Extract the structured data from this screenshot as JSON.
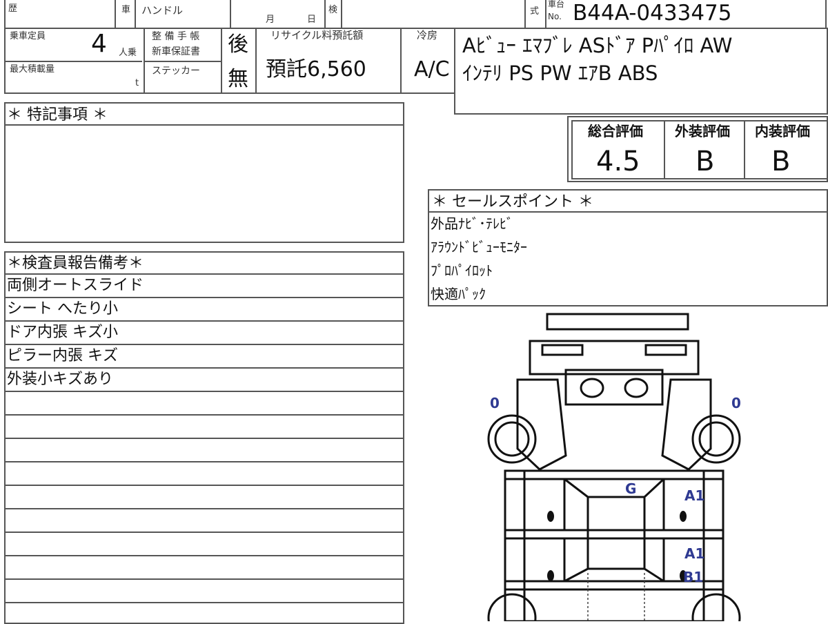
{
  "header": {
    "history_label": "歴",
    "car_label": "車",
    "handle_label": "ハンドル",
    "month_label": "月",
    "day_label": "日",
    "inspection_label": "検",
    "type_label": "式",
    "chassis_label": "車台",
    "no_label": "No.",
    "chassis_number": "B44A-0433475"
  },
  "specs": {
    "capacity_label": "乗車定員",
    "capacity_value": "4",
    "capacity_unit": "人乗",
    "max_load_label": "最大積載量",
    "max_load_unit": "t",
    "maintenance_label": "整 備 手 帳",
    "warranty_label": "新車保証書",
    "sticker_label": "ステッカー",
    "maintenance_value": "後",
    "sticker_value": "無",
    "recycle_label": "リサイクル料預託額",
    "recycle_value": "預託6,560",
    "aircon_label": "冷房",
    "aircon_value": "A/C"
  },
  "equipment": {
    "line1": "Aﾋﾞｭｰ ｴﾏﾌﾞﾚ ASﾄﾞｱ Pﾊﾟｲﾛ AW",
    "line2": "ｲﾝﾃﾘ PS PW ｴｱB ABS"
  },
  "grades": {
    "overall_label": "総合評価",
    "exterior_label": "外装評価",
    "interior_label": "内装評価",
    "overall_value": "4.5",
    "exterior_value": "B",
    "interior_value": "B"
  },
  "special_notes": {
    "title": "＊ 特記事項 ＊"
  },
  "sales_points": {
    "title": "＊ セールスポイント ＊",
    "items": [
      "外品ﾅﾋﾞ･ﾃﾚﾋﾞ",
      "ｱﾗｳﾝﾄﾞﾋﾞｭｰﾓﾆﾀｰ",
      "ﾌﾟﾛﾊﾟｲﾛｯﾄ",
      "快適ﾊﾟｯｸ"
    ]
  },
  "inspector_report": {
    "title": "＊検査員報告備考＊",
    "items": [
      "両側オートスライド",
      "シート へたり小",
      "ドア内張 キズ小",
      "ピラー内張 キズ",
      "外装小キズあり"
    ]
  },
  "diagram": {
    "marks": {
      "front_left_tire": "0",
      "front_right_tire": "0",
      "roof": "G",
      "right_front_door": "A1",
      "right_rear_door_1": "A1",
      "right_rear_door_2": "B1"
    },
    "mark_color": "#2f3a92"
  }
}
